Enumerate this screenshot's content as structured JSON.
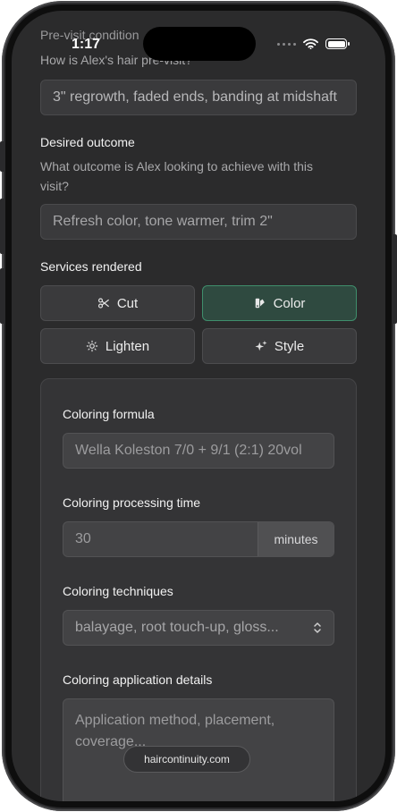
{
  "status": {
    "time": "1:17"
  },
  "form": {
    "previsit_label": "Pre-visit condition",
    "previsit_hint": "How is Alex's hair pre-visit?",
    "previsit_value": "3\" regrowth, faded ends, banding at midshaft",
    "outcome_label": "Desired outcome",
    "outcome_hint": "What outcome is Alex looking to achieve with this visit?",
    "outcome_value": "Refresh color, tone warmer, trim 2\"",
    "services_label": "Services rendered",
    "services": [
      {
        "label": "Cut",
        "icon": "scissors-icon",
        "active": false
      },
      {
        "label": "Color",
        "icon": "color-swatch-icon",
        "active": true
      },
      {
        "label": "Lighten",
        "icon": "sun-icon",
        "active": false
      },
      {
        "label": "Style",
        "icon": "sparkles-icon",
        "active": false
      }
    ]
  },
  "coloring": {
    "formula_label": "Coloring formula",
    "formula_value": "Wella Koleston 7/0 + 9/1 (2:1) 20vol",
    "time_label": "Coloring processing time",
    "time_value": "30",
    "time_unit": "minutes",
    "techniques_label": "Coloring techniques",
    "techniques_value": "balayage, root touch-up, gloss...",
    "details_label": "Coloring application details",
    "details_placeholder": "Application method, placement, coverage..."
  },
  "footer": {
    "domain": "haircontinuity.com"
  },
  "colors": {
    "accent": "#3f8e6c",
    "active_bg": "#2f4a40",
    "background": "#2b2b2c"
  }
}
